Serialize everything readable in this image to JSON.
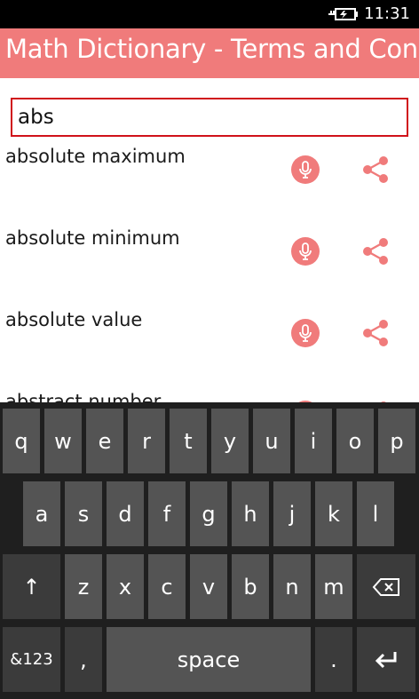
{
  "status_bar": {
    "time": "11:31",
    "battery_icon": "charging-battery-icon"
  },
  "header": {
    "title": "Math Dictionary - Terms and Concepts"
  },
  "search": {
    "value": "abs"
  },
  "results": [
    {
      "term": "absolute maximum"
    },
    {
      "term": "absolute minimum"
    },
    {
      "term": "absolute value"
    },
    {
      "term": "abstract number"
    }
  ],
  "item_actions": {
    "speak_icon": "microphone-icon",
    "share_icon": "share-icon"
  },
  "keyboard": {
    "row1": [
      "q",
      "w",
      "e",
      "r",
      "t",
      "y",
      "u",
      "i",
      "o",
      "p"
    ],
    "row2": [
      "a",
      "s",
      "d",
      "f",
      "g",
      "h",
      "j",
      "k",
      "l"
    ],
    "row3": [
      "z",
      "x",
      "c",
      "v",
      "b",
      "n",
      "m"
    ],
    "shift_label": "↑",
    "backspace_icon": "backspace-icon",
    "symbols_label": "&123",
    "comma_label": ",",
    "space_label": "space",
    "period_label": ".",
    "enter_icon": "enter-icon"
  },
  "colors": {
    "accent": "#f07b7b",
    "search_border": "#d0121a",
    "keyboard_bg": "#1f1f1f",
    "key_bg": "#545454",
    "key_special_bg": "#3b3b3b"
  }
}
